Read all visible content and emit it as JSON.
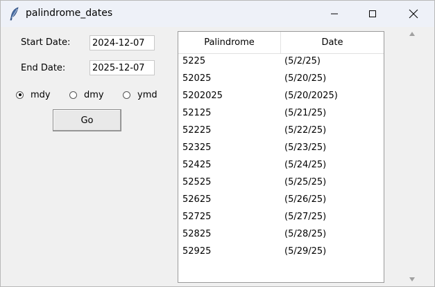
{
  "window": {
    "title": "palindrome_dates",
    "icon": "feather-icon"
  },
  "form": {
    "start_label": "Start Date:",
    "start_value": "2024-12-07",
    "end_label": "End Date:",
    "end_value": "2025-12-07",
    "formats": [
      {
        "label": "mdy",
        "selected": true
      },
      {
        "label": "dmy",
        "selected": false
      },
      {
        "label": "ymd",
        "selected": false
      }
    ],
    "go_label": "Go"
  },
  "table": {
    "columns": [
      "Palindrome",
      "Date"
    ],
    "rows": [
      [
        "5225",
        "(5/2/25)"
      ],
      [
        "52025",
        "(5/20/25)"
      ],
      [
        "5202025",
        "(5/20/2025)"
      ],
      [
        "52125",
        "(5/21/25)"
      ],
      [
        "52225",
        "(5/22/25)"
      ],
      [
        "52325",
        "(5/23/25)"
      ],
      [
        "52425",
        "(5/24/25)"
      ],
      [
        "52525",
        "(5/25/25)"
      ],
      [
        "52625",
        "(5/26/25)"
      ],
      [
        "52725",
        "(5/27/25)"
      ],
      [
        "52825",
        "(5/28/25)"
      ],
      [
        "52925",
        "(5/29/25)"
      ]
    ]
  }
}
